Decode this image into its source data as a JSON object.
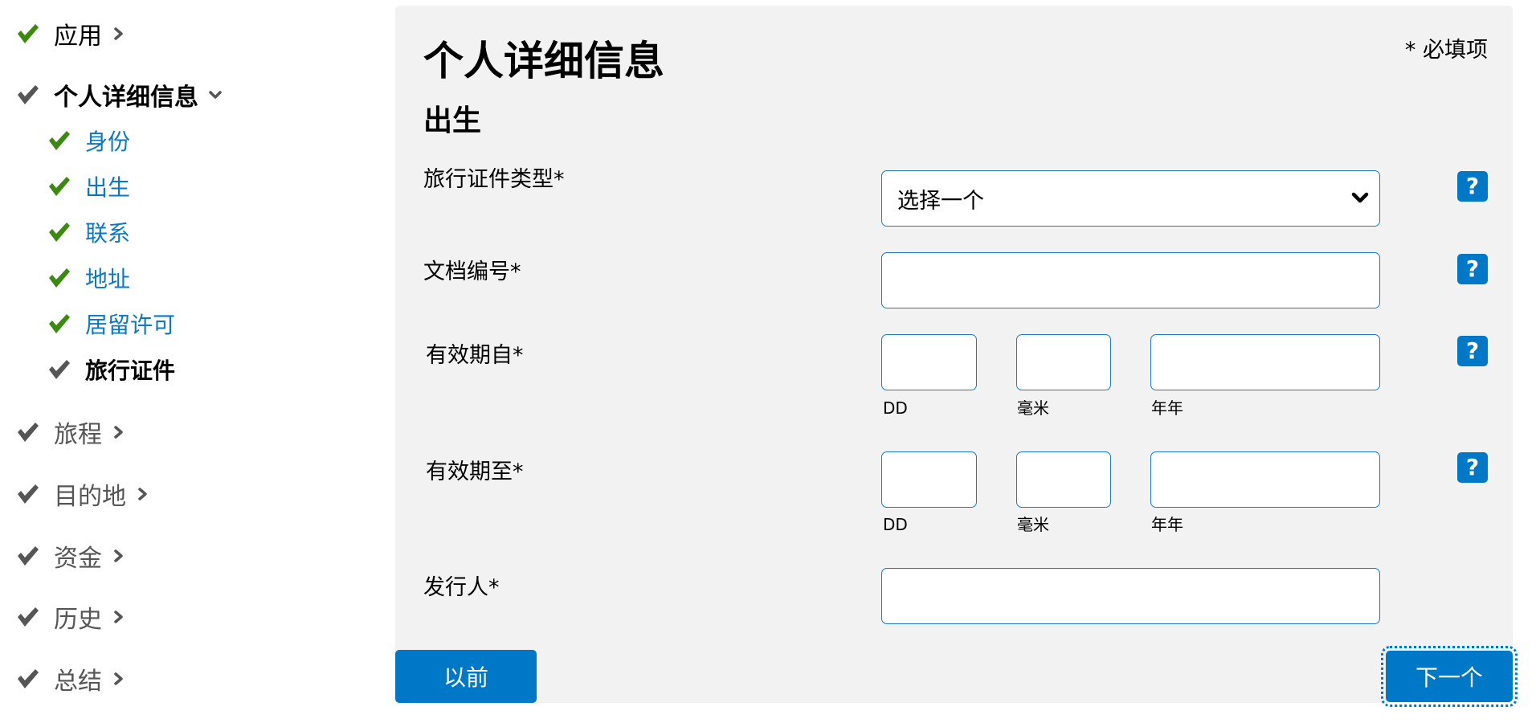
{
  "sidebar": {
    "top_items": [
      {
        "label": "应用",
        "status": "complete",
        "expand": "collapsed"
      },
      {
        "label": "个人详细信息",
        "status": "current",
        "expand": "expanded"
      },
      {
        "label": "旅程",
        "status": "pending",
        "expand": "collapsed"
      },
      {
        "label": "目的地",
        "status": "pending",
        "expand": "collapsed"
      },
      {
        "label": "资金",
        "status": "pending",
        "expand": "collapsed"
      },
      {
        "label": "历史",
        "status": "pending",
        "expand": "collapsed"
      },
      {
        "label": "总结",
        "status": "pending",
        "expand": "collapsed"
      }
    ],
    "sub_items": [
      {
        "label": "身份",
        "status": "complete"
      },
      {
        "label": "出生",
        "status": "complete"
      },
      {
        "label": "联系",
        "status": "complete"
      },
      {
        "label": "地址",
        "status": "complete"
      },
      {
        "label": "居留许可",
        "status": "complete"
      },
      {
        "label": "旅行证件",
        "status": "current"
      }
    ]
  },
  "main": {
    "title": "个人详细信息",
    "required_note": "* 必填项",
    "section_title": "出生",
    "fields": {
      "doc_type": {
        "label": "旅行证件类型*",
        "selected": "选择一个"
      },
      "doc_number": {
        "label": "文档编号*",
        "value": ""
      },
      "valid_from": {
        "label": "有效期自*",
        "dd": "",
        "mm": "",
        "yyyy": ""
      },
      "valid_to": {
        "label": "有效期至*",
        "dd": "",
        "mm": "",
        "yyyy": ""
      },
      "issuer": {
        "label": "发行人*",
        "value": ""
      }
    },
    "date_sub_labels": {
      "dd": "DD",
      "mm": "毫米",
      "yyyy": "年年"
    },
    "help_glyph": "?",
    "buttons": {
      "previous": "以前",
      "next": "下一个"
    }
  },
  "colors": {
    "accent": "#0078c8",
    "link": "#0a78c8",
    "check_complete": "#3a8a0f",
    "check_pending": "#555555",
    "panel_bg": "#f2f2f2"
  }
}
